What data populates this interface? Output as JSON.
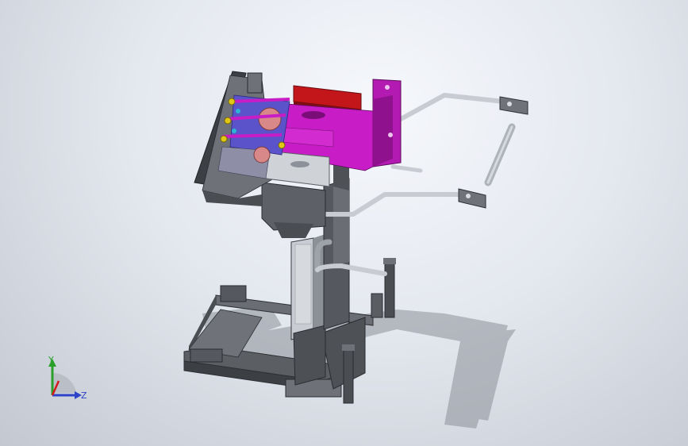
{
  "viewport": {
    "background_top": "#f4f6fa",
    "background_bottom": "#c3c8d1"
  },
  "colors": {
    "frame_gray": "#5b5e63",
    "frame_dark": "#3c3f44",
    "frame_light": "#9a9ea6",
    "magenta": "#c81cc6",
    "magenta_dark": "#8f118d",
    "red_block": "#c2161b",
    "silver": "#c8ccd2",
    "blue_part": "#5b53c9",
    "yellow_part": "#e0c814",
    "shadow": "#8d9199"
  },
  "triad": {
    "y_label": "Y",
    "z_label": "Z",
    "y_color": "#2aa02a",
    "z_color": "#2d43c8",
    "x_color": "#d41a1a"
  }
}
